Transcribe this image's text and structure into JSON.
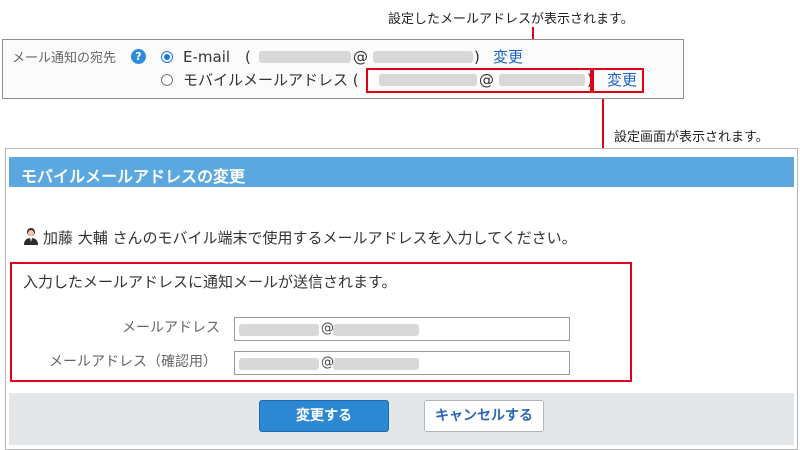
{
  "callouts": {
    "top": "設定したメールアドレスが表示されます。",
    "middle": "設定画面が表示されます。"
  },
  "notify_settings": {
    "label": "メール通知の宛先",
    "help_icon": "?",
    "email_option": {
      "label": "E-mail　(",
      "at": "@",
      "close": ")",
      "change_link": "変更",
      "selected": true
    },
    "mobile_option": {
      "label": "モバイルメールアドレス (",
      "at": "@",
      "close": ")",
      "change_link": "変更",
      "selected": false
    }
  },
  "dialog": {
    "title": "モバイルメールアドレスの変更",
    "intro_text": "加藤 大輔 さんのモバイル端末で使用するメールアドレスを入力してください。",
    "info_text": "入力したメールアドレスに通知メールが送信されます。",
    "fields": [
      {
        "label": "メールアドレス",
        "value_at": "@"
      },
      {
        "label": "メールアドレス（確認用）",
        "value_at": "@"
      }
    ],
    "buttons": {
      "primary": "変更する",
      "secondary": "キャンセルする"
    }
  },
  "colors": {
    "highlight": "#e0001b",
    "header": "#5ba7e0",
    "link": "#1a62c5",
    "primary_button": "#2d88d3"
  }
}
